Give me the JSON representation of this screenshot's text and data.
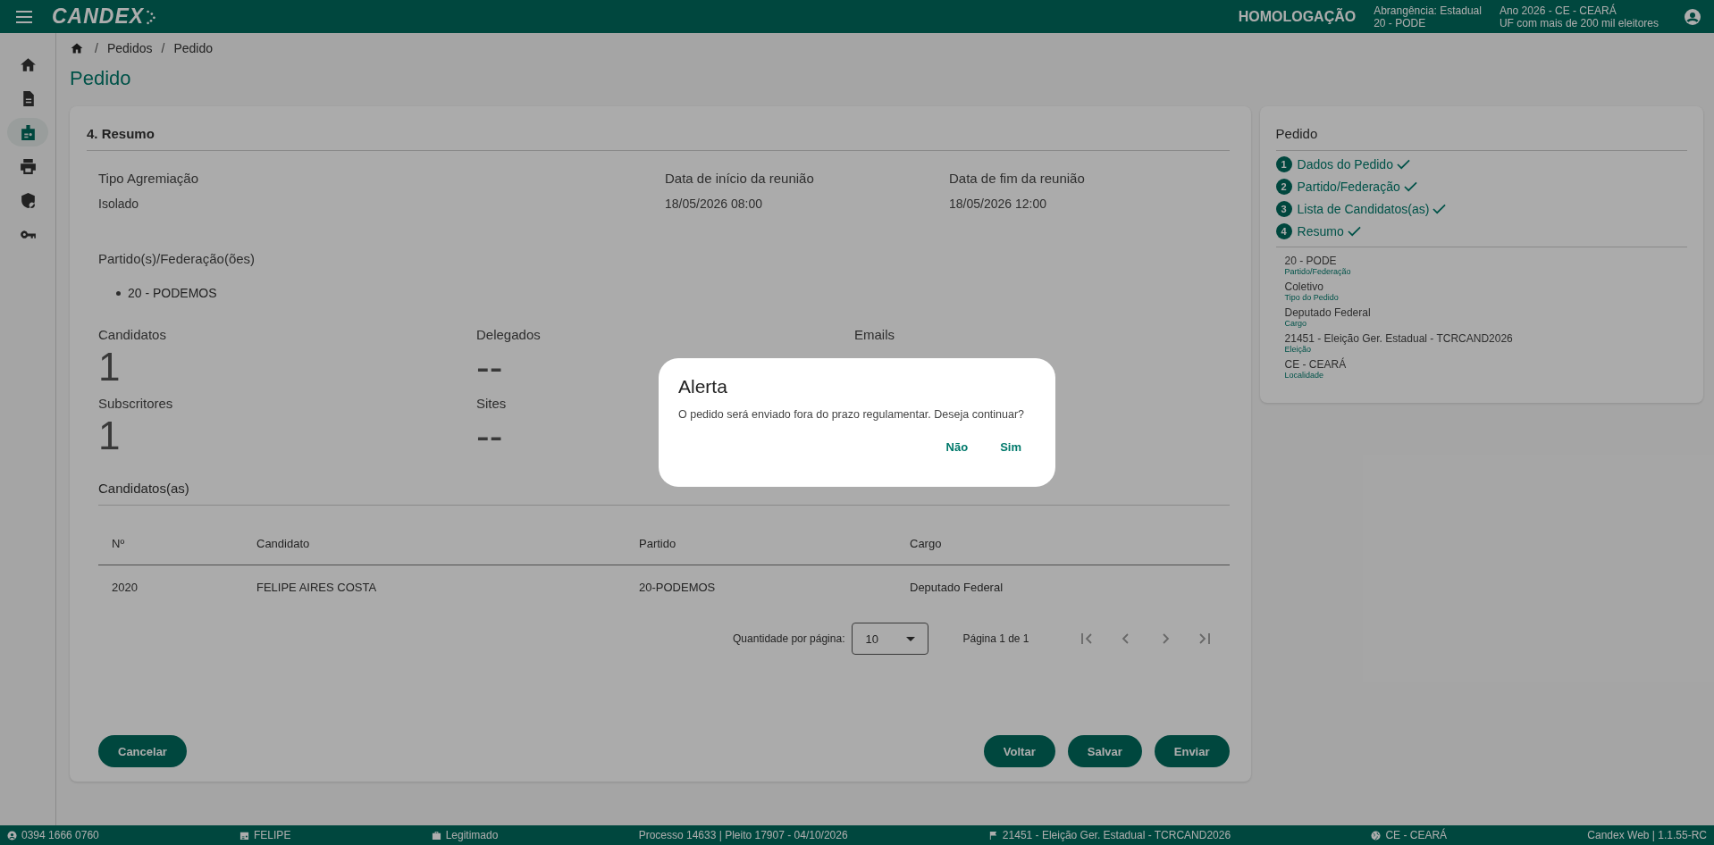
{
  "app": {
    "logo": "CANDEX",
    "environment": "HOMOLOGAÇÃO",
    "scope_label": "Abrangência: Estadual",
    "scope_party": "20 - PODE",
    "year": "Ano 2026 - CE - CEARÁ",
    "uf": "UF com mais de 200 mil eleitores"
  },
  "sidebar": [
    {
      "kind": "home",
      "selected": false
    },
    {
      "kind": "document",
      "selected": false
    },
    {
      "kind": "badge",
      "selected": true
    },
    {
      "kind": "printer",
      "selected": false
    },
    {
      "kind": "shield",
      "selected": false
    },
    {
      "kind": "key",
      "selected": false
    }
  ],
  "breadcrumb": [
    "Pedidos",
    "Pedido"
  ],
  "breadcrumb_separator": "/",
  "page_title": "Pedido",
  "summary": {
    "title": "4. Resumo",
    "fields": [
      {
        "label": "Tipo Agremiação",
        "value": "Isolado"
      },
      {
        "label": "Data de início da reunião",
        "value": "18/05/2026 08:00"
      },
      {
        "label": "Data de fim da reunião",
        "value": "18/05/2026 12:00"
      }
    ],
    "parties_label": "Partido(s)/Federação(ões)",
    "parties": [
      "20 - PODEMOS"
    ],
    "stats": [
      {
        "label": "Candidatos",
        "value": "1"
      },
      {
        "label": "Delegados",
        "value": "--"
      },
      {
        "label": "Emails"
      },
      {
        "label": "Subscritores",
        "value": "1"
      },
      {
        "label": "Sites",
        "value": "--"
      }
    ],
    "candidates_title": "Candidatos(as)",
    "table": {
      "columns": [
        "Nº",
        "Candidato",
        "Partido",
        "Cargo"
      ],
      "rows": [
        [
          "2020",
          "FELIPE AIRES COSTA",
          "20-PODEMOS",
          "Deputado Federal"
        ]
      ]
    },
    "pagination": {
      "page_size_label": "Quantidade por página:",
      "page_size": "10",
      "page_info": "Página 1 de 1",
      "nav": [
        {
          "kind": "first",
          "disabled": true
        },
        {
          "kind": "prev",
          "disabled": true
        },
        {
          "kind": "next",
          "disabled": true
        },
        {
          "kind": "last",
          "disabled": true
        }
      ]
    },
    "cancel": "Cancelar",
    "actions": [
      "Voltar",
      "Salvar",
      "Enviar"
    ]
  },
  "order_panel": {
    "title": "Pedido",
    "steps": [
      {
        "number": "1",
        "label": "Dados do Pedido",
        "done": true
      },
      {
        "number": "2",
        "label": "Partido/Federação",
        "done": true
      },
      {
        "number": "3",
        "label": "Lista de Candidatos(as)",
        "done": true
      },
      {
        "number": "4",
        "label": "Resumo",
        "done": true
      }
    ],
    "details": [
      {
        "value": "20 - PODE",
        "label": "Partido/Federação"
      },
      {
        "value": "Coletivo",
        "label": "Tipo do Pedido"
      },
      {
        "value": "Deputado Federal",
        "label": "Cargo"
      },
      {
        "value": "21451 - Eleição Ger. Estadual - TCRCAND2026",
        "label": "Eleição"
      },
      {
        "value": "CE - CEARÁ",
        "label": "Localidade"
      }
    ]
  },
  "dialog": {
    "title": "Alerta",
    "message": "O pedido será enviado fora do prazo regulamentar. Deseja continuar?",
    "buttons": [
      "Não",
      "Sim"
    ]
  },
  "status_bar": [
    {
      "kind": "account",
      "text": "0394 1666 0760"
    },
    {
      "kind": "badge",
      "text": "FELIPE"
    },
    {
      "kind": "briefcase",
      "text": "Legitimado"
    },
    {
      "kind": "none",
      "text": "Processo 14633 | Pleito 17907 - 04/10/2026"
    },
    {
      "kind": "flag",
      "text": "21451 - Eleição Ger. Estadual - TCRCAND2026"
    },
    {
      "kind": "globe",
      "text": "CE - CEARÁ"
    },
    {
      "kind": "none",
      "text": "Candex Web | 1.1.55-RC"
    }
  ]
}
